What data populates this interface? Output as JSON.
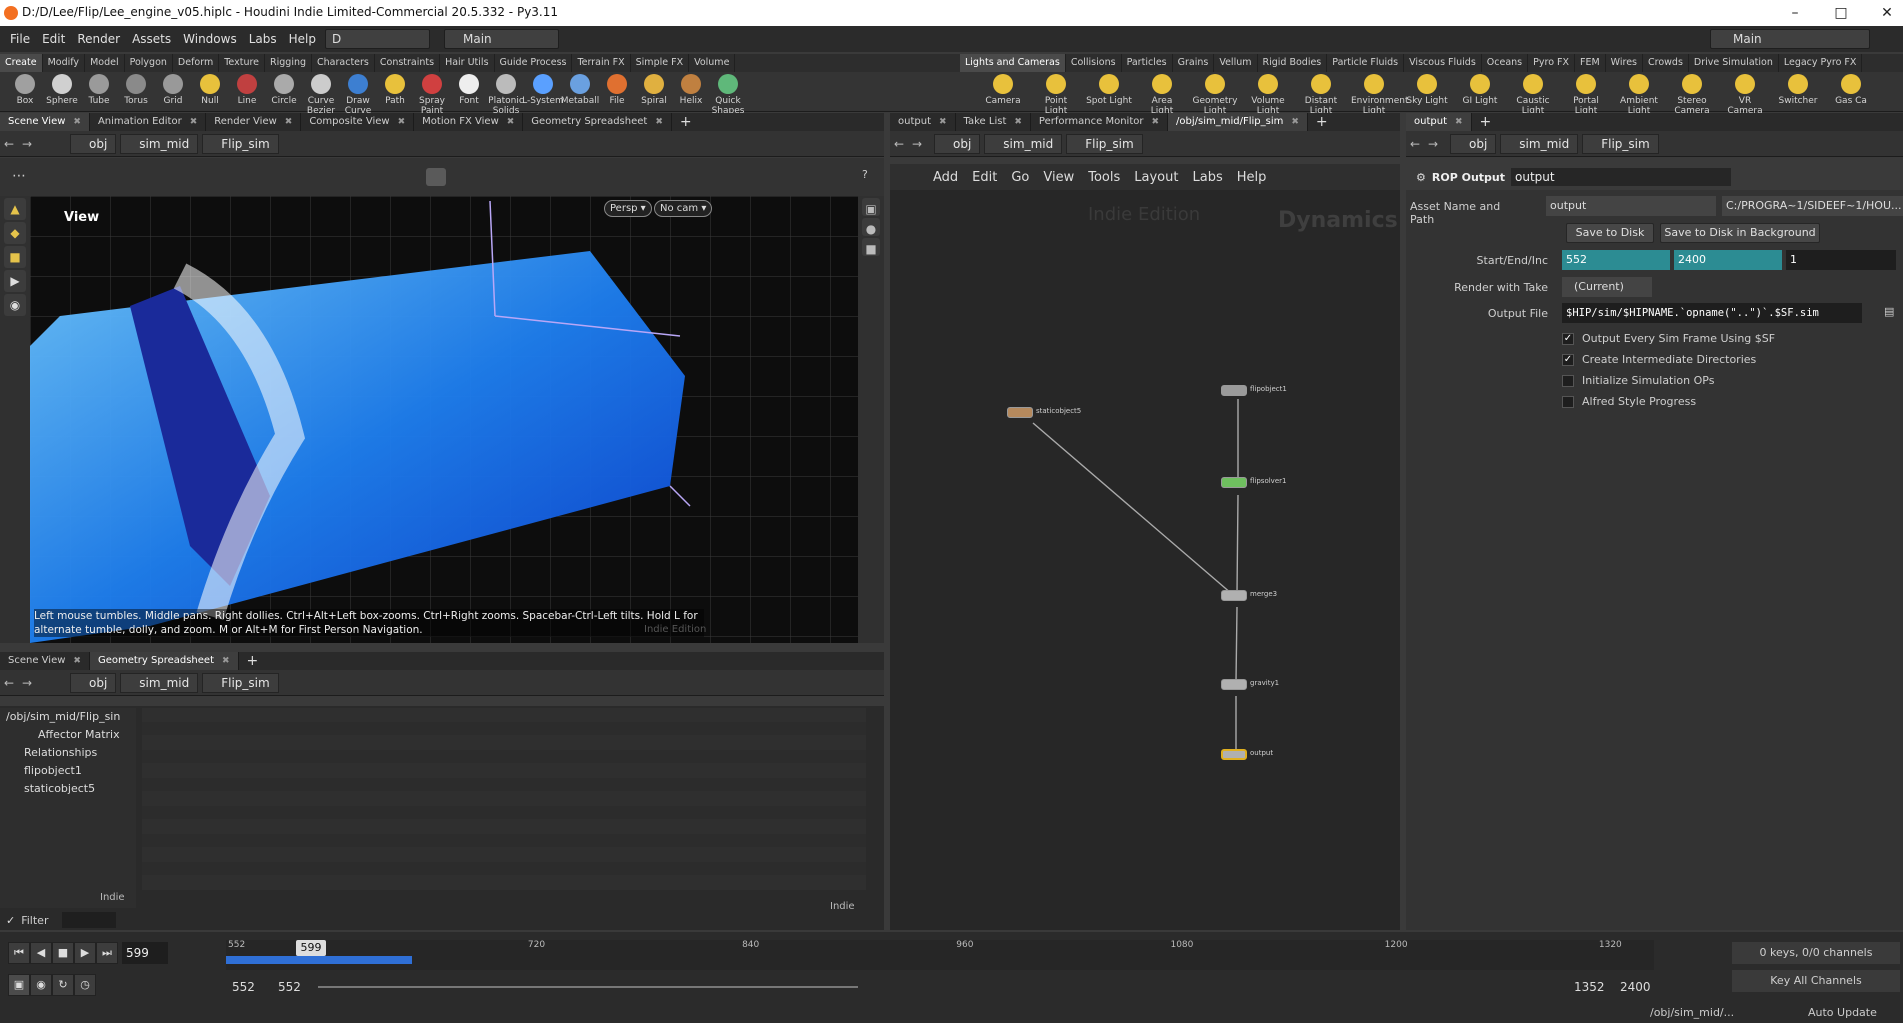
{
  "window": {
    "title": "D:/D/Lee/Flip/Lee_engine_v05.hiplc - Houdini Indie Limited-Commercial 20.5.332 - Py3.11"
  },
  "menubar": {
    "items": [
      "File",
      "Edit",
      "Render",
      "Assets",
      "Windows",
      "Labs",
      "Help"
    ],
    "desk_dropdown": "D",
    "main_dropdown": "Main",
    "right_dropdown": "Main"
  },
  "shelf_tabs_left": [
    "Create",
    "Modify",
    "Model",
    "Polygon",
    "Deform",
    "Texture",
    "Rigging",
    "Characters",
    "Constraints",
    "Hair Utils",
    "Guide Process",
    "Terrain FX",
    "Simple FX",
    "Volume"
  ],
  "shelf_tabs_right": [
    "Lights and Cameras",
    "Collisions",
    "Particles",
    "Grains",
    "Vellum",
    "Rigid Bodies",
    "Particle Fluids",
    "Viscous Fluids",
    "Oceans",
    "Pyro FX",
    "FEM",
    "Wires",
    "Crowds",
    "Drive Simulation",
    "Legacy Pyro FX"
  ],
  "shelf_tools_left": [
    "Box",
    "Sphere",
    "Tube",
    "Torus",
    "Grid",
    "Null",
    "Line",
    "Circle",
    "Curve Bezier",
    "Draw Curve",
    "Path",
    "Spray Paint",
    "Font",
    "Platonic Solids",
    "L-System",
    "Metaball",
    "File",
    "Spiral",
    "Helix",
    "Quick Shapes"
  ],
  "shelf_tools_right": [
    "Camera",
    "Point Light",
    "Spot Light",
    "Area Light",
    "Geometry Light",
    "Volume Light",
    "Distant Light",
    "Environment Light",
    "Sky Light",
    "GI Light",
    "Caustic Light",
    "Portal Light",
    "Ambient Light",
    "Stereo Camera",
    "VR Camera",
    "Switcher",
    "Gas Ca"
  ],
  "scene_pane": {
    "tabs": [
      "Scene View",
      "Animation Editor",
      "Render View",
      "Composite View",
      "Motion FX View",
      "Geometry Spreadsheet"
    ],
    "path": [
      "obj",
      "sim_mid",
      "Flip_sim"
    ],
    "view_label": "View",
    "persp": "Persp ▾",
    "cam": "No cam ▾",
    "hint": "Left mouse tumbles. Middle pans. Right dollies. Ctrl+Alt+Left box-zooms. Ctrl+Right zooms. Spacebar-Ctrl-Left tilts. Hold L for alternate tumble, dolly, and zoom. M or Alt+M for First Person Navigation.",
    "watermark": "Indie Edition"
  },
  "spreadsheet_pane": {
    "tabs": [
      "Scene View",
      "Geometry Spreadsheet"
    ],
    "path": [
      "obj",
      "sim_mid",
      "Flip_sim"
    ],
    "tree": [
      "/obj/sim_mid/Flip_sin",
      "Affector Matrix",
      "Relationships",
      "flipobject1",
      "staticobject5"
    ],
    "indie_left": "Indie",
    "indie_right": "Indie",
    "filter": "Filter"
  },
  "network_pane": {
    "tabs": [
      "output",
      "Take List",
      "Performance Monitor",
      "/obj/sim_mid/Flip_sim"
    ],
    "path": [
      "obj",
      "sim_mid",
      "Flip_sim"
    ],
    "menu": [
      "Add",
      "Edit",
      "Go",
      "View",
      "Tools",
      "Layout",
      "Labs",
      "Help"
    ],
    "watermark": "Indie Edition",
    "context": "Dynamics",
    "nodes": [
      {
        "name": "staticobject5"
      },
      {
        "name": "flipobject1"
      },
      {
        "name": "flipsolver1"
      },
      {
        "name": "merge3"
      },
      {
        "name": "gravity1"
      },
      {
        "name": "output"
      }
    ]
  },
  "params_pane": {
    "tabs": [
      "output"
    ],
    "path": [
      "obj",
      "sim_mid",
      "Flip_sim"
    ],
    "node_type": "ROP Output",
    "node_name": "output",
    "asset_label": "Asset Name and Path",
    "asset_value": "output",
    "asset_path": "C:/PROGRA~1/SIDEEF~1/HOU...",
    "save_to_disk": "Save to Disk",
    "save_bg": "Save to Disk in Background",
    "range_label": "Start/End/Inc",
    "start": "552",
    "end": "2400",
    "inc": "1",
    "take_label": "Render with Take",
    "take_value": "(Current)",
    "output_label": "Output File",
    "output_value": "$HIP/sim/$HIPNAME.`opname(\"..\")`.$SF.sim",
    "checks": [
      {
        "label": "Output Every Sim Frame Using $SF",
        "checked": true
      },
      {
        "label": "Create Intermediate Directories",
        "checked": true
      },
      {
        "label": "Initialize Simulation OPs",
        "checked": false
      },
      {
        "label": "Alfred Style Progress",
        "checked": false
      }
    ]
  },
  "timeline": {
    "current_frame": "599",
    "marker": "599",
    "ticks": [
      "552",
      "720",
      "840",
      "960",
      "1080",
      "1200",
      "1320"
    ],
    "cached_fraction": 0.13,
    "range_start": "552",
    "range_start2": "552",
    "range_end": "1352",
    "range_end2": "2400",
    "keys_info": "0 keys, 0/0 channels",
    "key_all": "Key All Channels",
    "status_path": "/obj/sim_mid/...",
    "auto_update": "Auto Update"
  }
}
